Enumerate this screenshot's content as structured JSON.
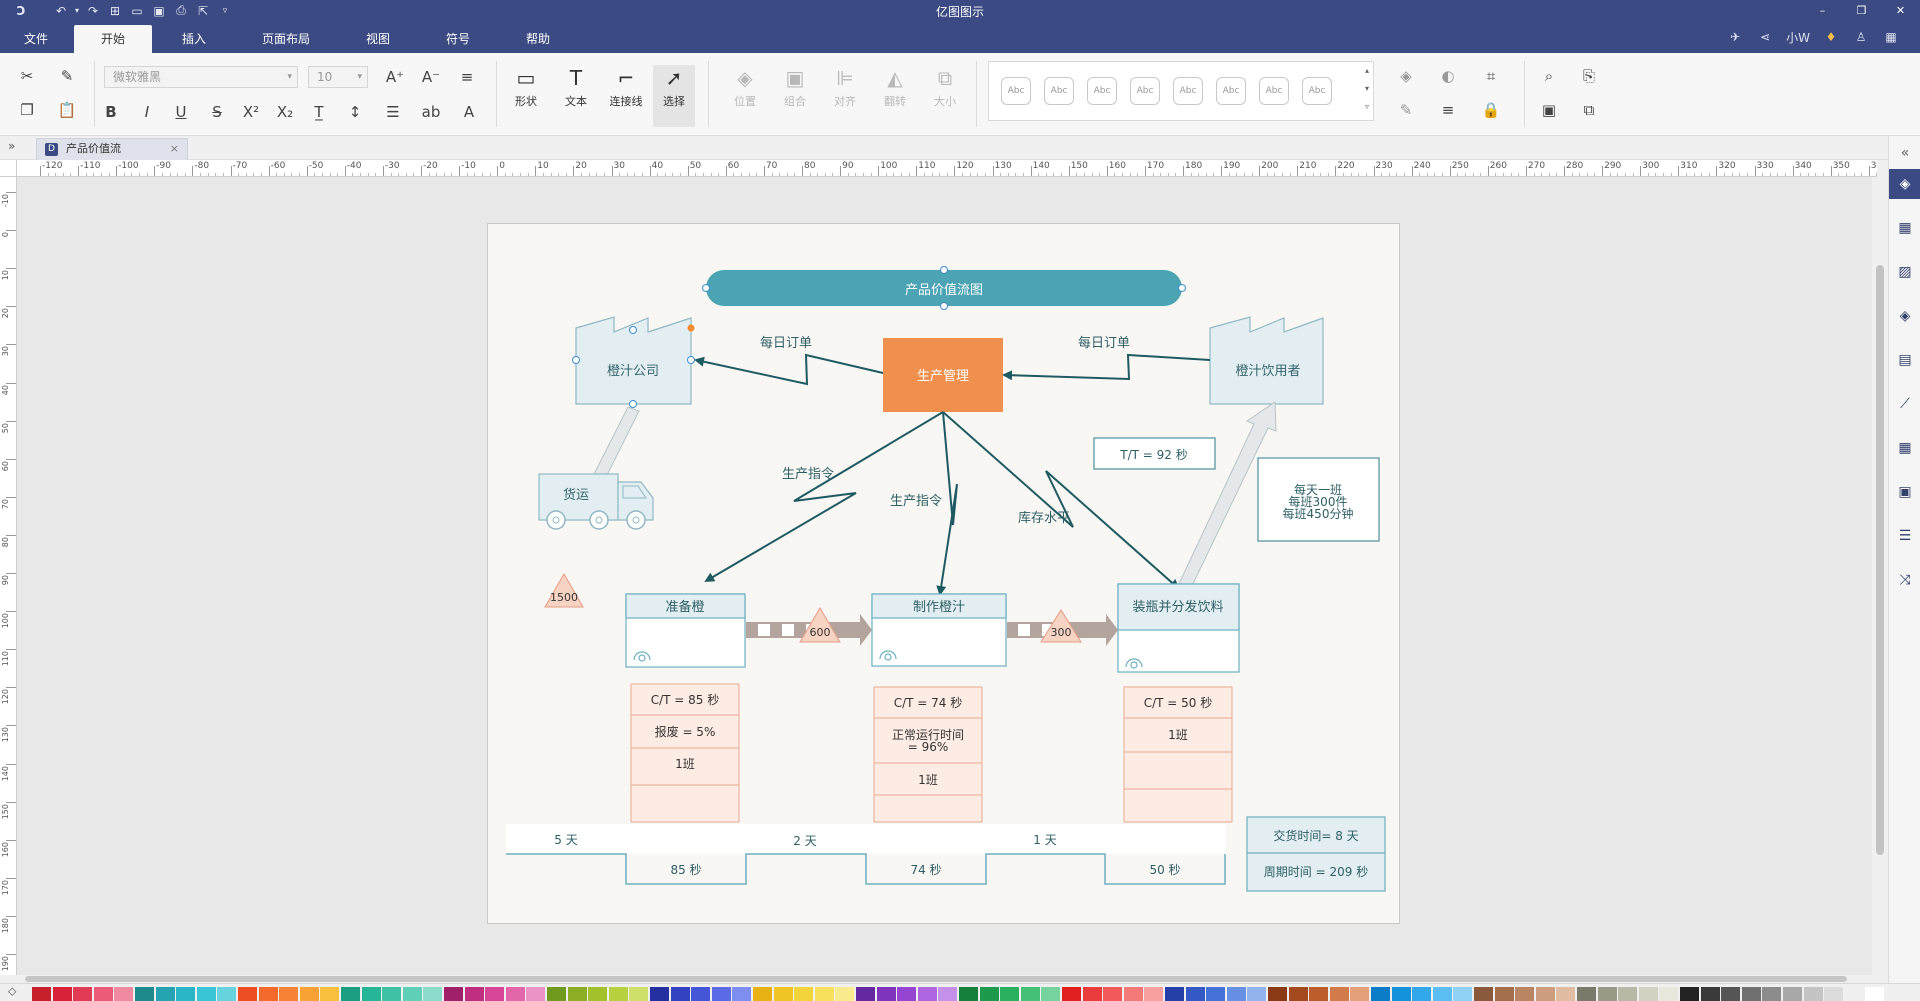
{
  "app": {
    "title": "亿图图示",
    "user": "小W",
    "menu_tabs": [
      "文件",
      "开始",
      "插入",
      "页面布局",
      "视图",
      "符号",
      "帮助"
    ],
    "active_tab": "开始"
  },
  "ribbon": {
    "font_family": "微软雅黑",
    "font_size": "10",
    "big_buttons": [
      {
        "label": "形状",
        "icon": "rectangle-icon"
      },
      {
        "label": "文本",
        "icon": "text-icon"
      },
      {
        "label": "连接线",
        "icon": "connector-icon"
      },
      {
        "label": "选择",
        "icon": "select-arrow-icon"
      }
    ],
    "arrange_buttons": [
      "位置",
      "组合",
      "对齐",
      "翻转",
      "大小"
    ],
    "style_samples": [
      "Abc",
      "Abc",
      "Abc",
      "Abc",
      "Abc",
      "Abc",
      "Abc",
      "Abc"
    ]
  },
  "document": {
    "tab_name": "产品价值流",
    "close_symbol": "×"
  },
  "rulers": {
    "horizontal": [
      "-120",
      "-110",
      "-100",
      "-90",
      "-80",
      "-70",
      "-60",
      "-50",
      "-40",
      "-30",
      "-20",
      "-10",
      "0",
      "10",
      "20",
      "30",
      "40",
      "50",
      "60",
      "70",
      "80",
      "90",
      "100",
      "110",
      "120",
      "130",
      "140",
      "150",
      "160",
      "170",
      "180",
      "190",
      "200",
      "210",
      "220",
      "230",
      "240",
      "250",
      "260",
      "270",
      "280",
      "290",
      "300",
      "310",
      "320",
      "330",
      "340",
      "350",
      "360"
    ],
    "vertical": [
      "-10",
      "0",
      "10",
      "20",
      "30",
      "40",
      "50",
      "60",
      "70",
      "80",
      "90",
      "100",
      "110",
      "120",
      "130",
      "140",
      "150",
      "160",
      "170",
      "180",
      "190"
    ]
  },
  "diagram": {
    "title": "产品价值流图",
    "supplier": "橙汁公司",
    "customer": "橙汁饮用者",
    "control": "生产管理",
    "daily_order_left": "每日订单",
    "daily_order_right": "每日订单",
    "truck": "货运",
    "takt": "T/T = 92 秒",
    "shift_info": [
      "每天一班",
      "每班300件",
      "每班450分钟"
    ],
    "instructions": [
      "生产指令",
      "生产指令",
      "库存水平"
    ],
    "inventory": [
      "1500",
      "600",
      "300"
    ],
    "processes": [
      {
        "name": "准备橙",
        "data": [
          "C/T = 85 秒",
          "报废 = 5%",
          "1班",
          ""
        ]
      },
      {
        "name": "制作橙汁",
        "data": [
          "C/T = 74 秒",
          "正常运行时间",
          "= 96%",
          "1班",
          ""
        ]
      },
      {
        "name": "装瓶并分发饮料",
        "data": [
          "C/T = 50 秒",
          "1班",
          "",
          ""
        ]
      }
    ],
    "timeline_days": [
      "5 天",
      "2 天",
      "1 天"
    ],
    "timeline_secs": [
      "85 秒",
      "74 秒",
      "50 秒"
    ],
    "summary": {
      "lead_time": "交货时间= 8 天",
      "cycle_time": "周期时间 = 209 秒"
    }
  },
  "colors": {
    "title_bar": "#3b4a82",
    "banner": "#4ba3b3",
    "control_box": "#f0904f",
    "arrow": "#1e5a62",
    "factory_fill": "#e2eef1",
    "factory_stroke": "#8fb8c4",
    "process_stroke": "#6cb0c0",
    "data_fill": "#fcece4",
    "data_stroke": "#e8a990",
    "inventory_fill": "#f7d3c4"
  },
  "palette": [
    "#c8202a",
    "#d9213a",
    "#e23b55",
    "#ec5b77",
    "#f08aa0",
    "#1f8a8c",
    "#25a3b0",
    "#2bb6c8",
    "#39c5d5",
    "#66d3df",
    "#ee4e24",
    "#f36a2c",
    "#f68235",
    "#f8a236",
    "#f9bf3f",
    "#1b9e82",
    "#27b597",
    "#40c2a6",
    "#5fcfb7",
    "#8cdccb",
    "#a0206a",
    "#c02e80",
    "#d64596",
    "#e366ab",
    "#eb93c6",
    "#6f9a1e",
    "#8cae24",
    "#a2c12b",
    "#b8d13e",
    "#cfe06a",
    "#2530a0",
    "#3342c0",
    "#4455d8",
    "#5b6be6",
    "#7d8ef0",
    "#e8b214",
    "#efc424",
    "#f3d43a",
    "#f6e05c",
    "#f9eb8e",
    "#6428a0",
    "#7e34bc",
    "#9545d1",
    "#ad66df",
    "#c490ea",
    "#14803c",
    "#1e9a4c",
    "#29b05e",
    "#44c177",
    "#77d39e",
    "#e02020",
    "#ea3c3c",
    "#f05a5a",
    "#f47a7a",
    "#f8a0a0",
    "#2440a8",
    "#3458c4",
    "#4671d8",
    "#6690e4",
    "#92b3ee",
    "#8a3a14",
    "#a54a1e",
    "#bd5d2c",
    "#d27a4a",
    "#e3a07a",
    "#0a7cc8",
    "#1592dc",
    "#32a8ea",
    "#5cbdf0",
    "#8fd2f5",
    "#8a5a3c",
    "#a26e4c",
    "#b98562",
    "#cc9e7e",
    "#dfbca2",
    "#7a7a6a",
    "#9a9a88",
    "#b8b8a6",
    "#d2d2c2",
    "#e8e8dc",
    "#222222",
    "#3a3a3a",
    "#555555",
    "#707070",
    "#8c8c8c",
    "#a8a8a8",
    "#c4c4c4",
    "#dcdcdc",
    "#efefef",
    "#ffffff"
  ]
}
